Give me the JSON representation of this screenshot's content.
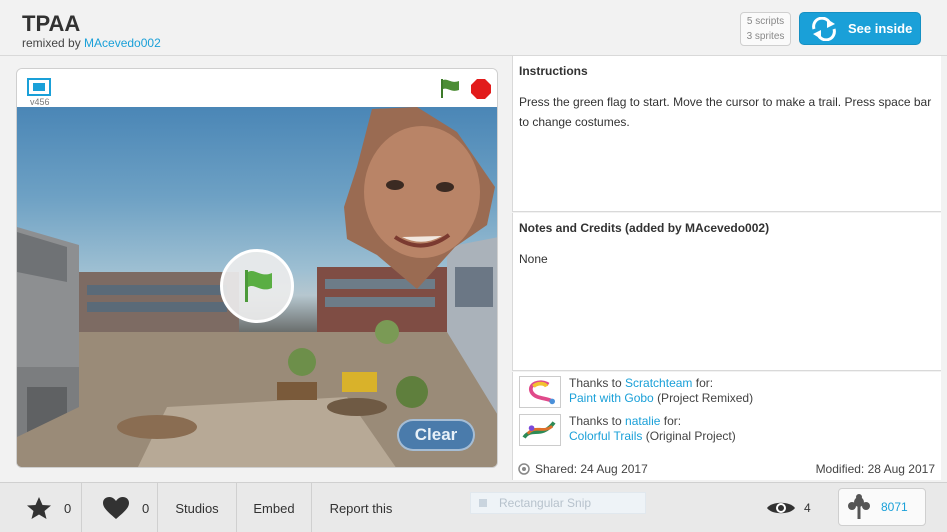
{
  "header": {
    "title": "TPAA",
    "remixed_by_prefix": "remixed by",
    "remixed_by_user": "MAcevedo002",
    "scripts": "5 scripts",
    "sprites": "3 sprites",
    "see_inside": "See inside"
  },
  "player": {
    "version": "v456",
    "clear": "Clear"
  },
  "instructions": {
    "title": "Instructions",
    "text": "Press the green flag to start. Move the cursor to make a trail. Press space bar to change costumes."
  },
  "notes": {
    "title": "Notes and Credits (added by MAcevedo002)",
    "text": "None"
  },
  "credits": [
    {
      "prefix": "Thanks to",
      "user": "Scratchteam",
      "suffix": "for:",
      "project": "Paint with Gobo",
      "note": "(Project Remixed)"
    },
    {
      "prefix": "Thanks to",
      "user": "natalie",
      "suffix": "for:",
      "project": "Colorful Trails",
      "note": "(Original Project)"
    }
  ],
  "dates": {
    "shared": "Shared: 24 Aug 2017",
    "modified": "Modified: 28 Aug 2017"
  },
  "footer": {
    "favorites": "0",
    "loves": "0",
    "studios": "Studios",
    "embed": "Embed",
    "report": "Report this",
    "snip": "Rectangular Snip",
    "views": "4",
    "remixes": "8071"
  },
  "colors": {
    "accent": "#1aa0d8",
    "flag_green": "#4caf50",
    "stop_red": "#e21b1b"
  }
}
